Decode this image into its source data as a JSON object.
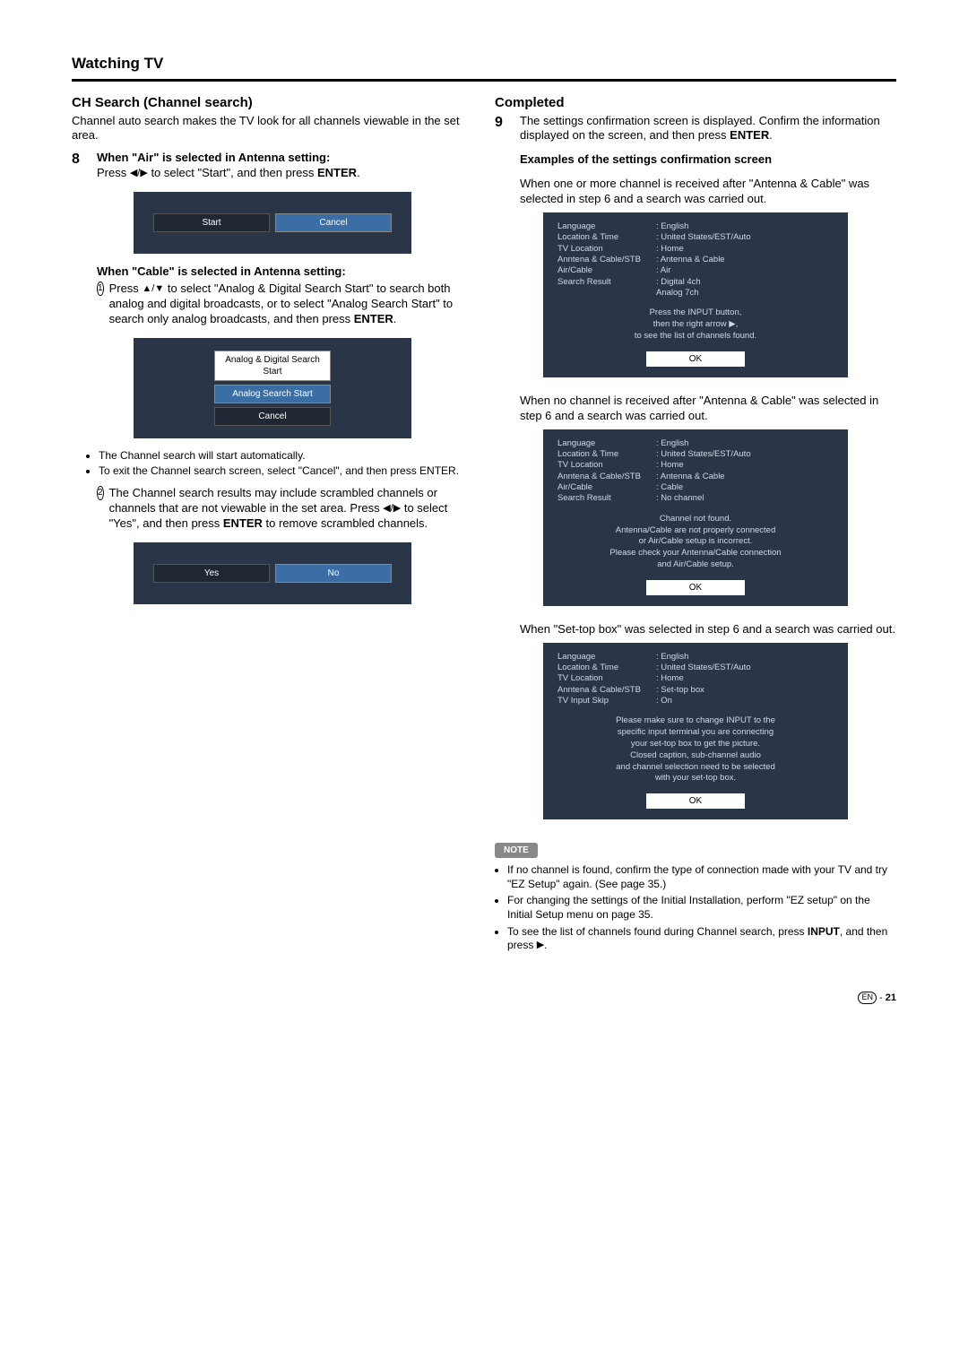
{
  "title": "Watching TV",
  "left": {
    "heading": "CH Search (Channel search)",
    "intro": "Channel auto search makes the TV look for all channels viewable in the set area.",
    "step8num": "8",
    "step8a": "When \"Air\" is selected in Antenna setting:",
    "step8b_prefix": "Press ",
    "step8b_mid": " to select \"Start\", and then press ",
    "step8b_enter": "ENTER",
    "dialog1": {
      "start": "Start",
      "cancel": "Cancel"
    },
    "cable_heading": "When \"Cable\" is selected in Antenna setting:",
    "circ1": "1",
    "cable_step1_a": "Press ",
    "cable_step1_b": " to select \"Analog & Digital Search Start\" to search both analog and digital broadcasts, or to select \"Analog Search Start\" to search only analog broadcasts, and then press ",
    "cable_step1_enter": "ENTER",
    "dialog2": {
      "opt1": "Analog & Digital Search Start",
      "opt2": "Analog Search Start",
      "cancel": "Cancel"
    },
    "bullets": [
      "The Channel search will start automatically.",
      "To exit the Channel search screen, select \"Cancel\", and then press ENTER."
    ],
    "circ2": "2",
    "cable_step2_a": "The Channel search results may include scrambled channels or channels that are not viewable in the set area. Press ",
    "cable_step2_b": " to select \"Yes\", and then press ",
    "cable_step2_enter": "ENTER",
    "cable_step2_c": " to remove scrambled channels.",
    "dialog3": {
      "yes": "Yes",
      "no": "No"
    }
  },
  "right": {
    "heading": "Completed",
    "step9num": "9",
    "step9text_a": "The settings confirmation screen is displayed. Confirm the information displayed on the screen, and then press ",
    "step9text_enter": "ENTER",
    "examples_heading": "Examples of the settings confirmation screen",
    "case1": "When one or more channel is received after \"Antenna & Cable\" was selected in step 6 and a search was carried out.",
    "confirm1": {
      "rows": [
        [
          "Language",
          ": English"
        ],
        [
          "Location & Time",
          ": United States/EST/Auto"
        ],
        [
          "TV Location",
          ": Home"
        ],
        [
          "Anntena & Cable/STB",
          ": Antenna & Cable"
        ],
        [
          "Air/Cable",
          ": Air"
        ],
        [
          "Search Result",
          ": Digital 4ch"
        ],
        [
          "",
          "  Analog 7ch"
        ]
      ],
      "msg": "Press the INPUT button,\nthen the right arrow ▶,\nto see the list of channels found.",
      "ok": "OK"
    },
    "case2": "When no channel is received after \"Antenna & Cable\" was selected in step 6 and a search was carried out.",
    "confirm2": {
      "rows": [
        [
          "Language",
          ": English"
        ],
        [
          "Location & Time",
          ": United States/EST/Auto"
        ],
        [
          "TV Location",
          ": Home"
        ],
        [
          "Anntena & Cable/STB",
          ": Antenna & Cable"
        ],
        [
          "Air/Cable",
          ": Cable"
        ],
        [
          "Search Result",
          ": No channel"
        ]
      ],
      "msg": "Channel not found.\nAntenna/Cable are not properly connected\nor Air/Cable setup is incorrect.\nPlease check your Antenna/Cable connection\nand Air/Cable setup.",
      "ok": "OK"
    },
    "case3": "When \"Set-top box\" was selected in step 6 and a search was carried out.",
    "confirm3": {
      "rows": [
        [
          "Language",
          ": English"
        ],
        [
          "Location & Time",
          ": United States/EST/Auto"
        ],
        [
          "TV Location",
          ": Home"
        ],
        [
          "Anntena & Cable/STB",
          ": Set-top box"
        ],
        [
          "TV Input Skip",
          ": On"
        ]
      ],
      "msg": "Please make sure to change INPUT to the\nspecific input terminal you are connecting\nyour set-top box to get the picture.\nClosed caption, sub-channel audio\nand channel selection need to be selected\nwith your set-top box.",
      "ok": "OK"
    },
    "note_label": "NOTE",
    "notes": [
      "If no channel is found, confirm the type of connection made with your TV and try \"EZ Setup\" again. (See page 35.)",
      "For changing the settings of the Initial Installation, perform \"EZ setup\" on the Initial Setup menu on page 35.",
      "To see the list of channels found during Channel search, press INPUT, and then press ▶."
    ]
  },
  "page": {
    "en": "EN",
    "sep": " - ",
    "num": "21"
  }
}
